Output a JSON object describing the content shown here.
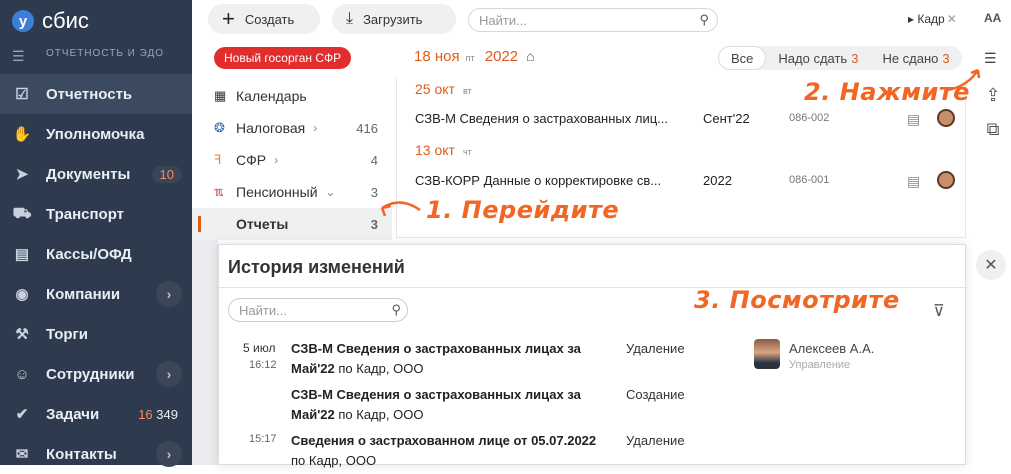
{
  "app": {
    "logo_text": "сбис",
    "subtitle": "ОТЧЕТНОСТЬ И ЭДО"
  },
  "sidebar": {
    "items": [
      {
        "label": "Отчетность",
        "icon": "report-icon",
        "active": true
      },
      {
        "label": "Уполномочка",
        "icon": "handshake-icon"
      },
      {
        "label": "Документы",
        "icon": "paper-plane-icon",
        "count": "10"
      },
      {
        "label": "Транспорт",
        "icon": "truck-icon"
      },
      {
        "label": "Кассы/ОФД",
        "icon": "cash-register-icon"
      },
      {
        "label": "Компании",
        "icon": "location-icon",
        "arrow": true
      },
      {
        "label": "Торги",
        "icon": "gavel-icon"
      },
      {
        "label": "Сотрудники",
        "icon": "people-icon",
        "arrow": true
      },
      {
        "label": "Задачи",
        "icon": "tasks-icon",
        "count_orange": "16",
        "count": "349"
      },
      {
        "label": "Контакты",
        "icon": "chat-icon",
        "arrow": true
      }
    ]
  },
  "toolbar": {
    "create": "Создать",
    "upload": "Загрузить",
    "search_placeholder": "Найти...",
    "filter_tag": "Кадр",
    "aa": "AA"
  },
  "badge": "Новый госорган СФР",
  "date": {
    "day": "18",
    "month": "ноя",
    "weekday": "пт",
    "year": "2022"
  },
  "segments": [
    {
      "label": "Все"
    },
    {
      "label": "Надо сдать",
      "count": "3"
    },
    {
      "label": "Не сдано",
      "count": "3"
    }
  ],
  "menu": [
    {
      "label": "Календарь",
      "icon": "calendar-icon"
    },
    {
      "label": "Налоговая",
      "icon": "tax-icon",
      "count": "416"
    },
    {
      "label": "СФР",
      "icon": "sfr-icon",
      "count": "4"
    },
    {
      "label": "Пенсионный",
      "icon": "pension-icon",
      "count": "3"
    },
    {
      "label": "Отчеты",
      "count": "3"
    }
  ],
  "reports": [
    {
      "day": "25",
      "month": "окт",
      "weekday": "вт",
      "title": "СЗВ-М Сведения о застрахованных лиц...",
      "period": "Сент'22",
      "code": "086-002"
    },
    {
      "day": "13",
      "month": "окт",
      "weekday": "чт",
      "title": "СЗВ-КОРР Данные о корректировке св...",
      "period": "2022",
      "code": "086-001"
    }
  ],
  "annotations": {
    "step1": "1. Перейдите",
    "step2": "2. Нажмите",
    "step3": "3. Посмотрите"
  },
  "dialog": {
    "title": "История изменений",
    "search_placeholder": "Найти...",
    "rows": [
      {
        "date": "5 июл",
        "time": "16:12",
        "doc_bold": "СЗВ-М Сведения о застрахованных лицах за Май'22",
        "doc_rest": " по Кадр, ООО",
        "action": "Удаление",
        "user": "Алексеев А.А.",
        "role": "Управление"
      },
      {
        "doc_bold": "СЗВ-М Сведения о застрахованных лицах за Май'22",
        "doc_rest": " по Кадр, ООО",
        "action": "Создание"
      },
      {
        "time": "15:17",
        "doc_bold": "Сведения о застрахованном лице от 05.07.2022",
        "doc_rest": " по Кадр, ООО",
        "action": "Удаление"
      }
    ]
  }
}
